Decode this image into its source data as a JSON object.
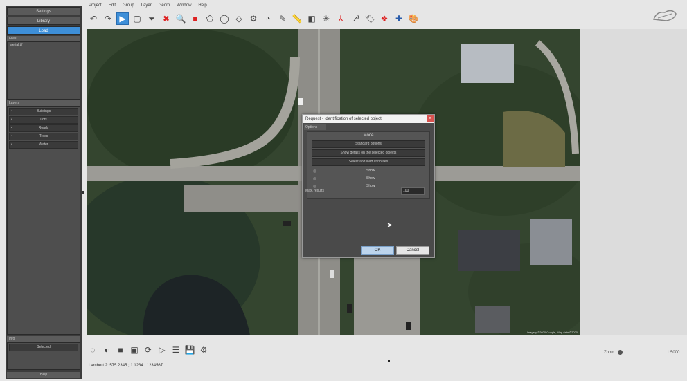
{
  "menu": [
    "Project",
    "Edit",
    "Group",
    "Layer",
    "Geom",
    "Window",
    "Help"
  ],
  "toolbar": {
    "tools": [
      {
        "name": "undo-icon",
        "glyph": "↶"
      },
      {
        "name": "redo-icon",
        "glyph": "↷"
      },
      {
        "name": "select-arrow-icon",
        "glyph": "▶",
        "selected": true
      },
      {
        "name": "rectangle-select-icon",
        "glyph": "▢"
      },
      {
        "name": "filter-icon",
        "glyph": "⏷"
      },
      {
        "name": "delete-icon",
        "glyph": "✖",
        "red": true
      },
      {
        "name": "zoom-icon",
        "glyph": "🔍"
      },
      {
        "name": "stop-icon",
        "glyph": "■",
        "red": true
      },
      {
        "name": "polygon-icon",
        "glyph": "⬠"
      },
      {
        "name": "circle-tool-icon",
        "glyph": "◯"
      },
      {
        "name": "diamond-tool-icon",
        "glyph": "◇"
      },
      {
        "name": "gear-tool-icon",
        "glyph": "⚙"
      },
      {
        "name": "clock-tool-icon",
        "glyph": "◔"
      },
      {
        "name": "draw-line-icon",
        "glyph": "✎"
      },
      {
        "name": "ruler-icon",
        "glyph": "📏"
      },
      {
        "name": "split-icon",
        "glyph": "◧"
      },
      {
        "name": "node-icon",
        "glyph": "✳"
      },
      {
        "name": "pdf-export-icon",
        "glyph": "⅄",
        "red": true
      },
      {
        "name": "branch-icon",
        "glyph": "⎇"
      },
      {
        "name": "tag-icon",
        "glyph": "🏷"
      },
      {
        "name": "layers-icon",
        "glyph": "❖",
        "red": true
      },
      {
        "name": "crosshair-icon",
        "glyph": "✚",
        "blue": true
      },
      {
        "name": "palette-icon",
        "glyph": "🎨"
      }
    ]
  },
  "left_panel": {
    "top_buttons": [
      "Settings",
      "Library",
      "Load"
    ],
    "files_header": "Files",
    "files": [
      "aerial.tif"
    ],
    "layers_header": "Layers",
    "layers": [
      "Buildings",
      "Lots",
      "Roads",
      "Trees",
      "Water"
    ],
    "bottom_header": "Info",
    "bottom_button": "Selected",
    "bottom_footer": "Help"
  },
  "dialog": {
    "title": "Request - Identification of selected object",
    "tab": "Options",
    "group_title": "Mode",
    "buttons": [
      "Standard options",
      "Show details on the selected objects",
      "Select and load attributes"
    ],
    "radio_options": [
      "Show",
      "Show",
      "Show"
    ],
    "max_label": "Max. results",
    "max_value": "100",
    "ok_label": "OK",
    "cancel_label": "Cancel"
  },
  "map": {
    "attribution": "Imagery ©2020 Google, Map data ©2020"
  },
  "bottom_tools": [
    {
      "name": "circle-select-icon",
      "glyph": "◌"
    },
    {
      "name": "globe-icon",
      "glyph": "◐"
    },
    {
      "name": "square-stop-icon",
      "glyph": "■"
    },
    {
      "name": "screenshot-icon",
      "glyph": "▣"
    },
    {
      "name": "refresh-icon",
      "glyph": "⟳"
    },
    {
      "name": "play-icon",
      "glyph": "▷"
    },
    {
      "name": "list-icon",
      "glyph": "☰"
    },
    {
      "name": "save-icon",
      "glyph": "💾"
    },
    {
      "name": "settings-icon",
      "glyph": "⚙"
    }
  ],
  "status": {
    "coordinates": "Lambert 2: 575.2345 ; 1.1234 ; 1234567",
    "zoom_label": "Zoom",
    "scale": "1:5000"
  }
}
